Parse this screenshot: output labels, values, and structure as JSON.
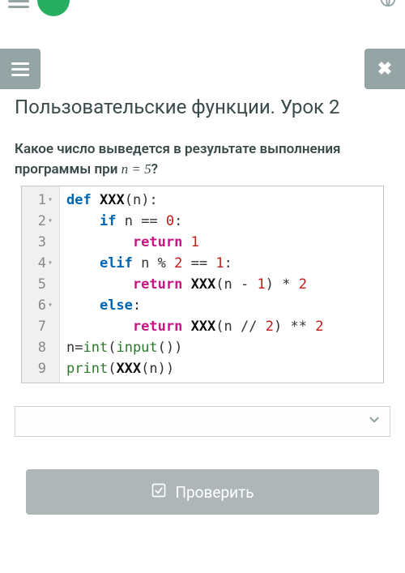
{
  "page": {
    "title": "Пользовательские функции. Урок 2"
  },
  "question": {
    "prefix": "Какое число выведется в результате выполнения программы при ",
    "var": "n",
    "eq": " = ",
    "val": "5",
    "suffix": "?"
  },
  "code": {
    "lines": [
      {
        "n": "1",
        "fold": true
      },
      {
        "n": "2",
        "fold": true
      },
      {
        "n": "3",
        "fold": false
      },
      {
        "n": "4",
        "fold": true
      },
      {
        "n": "5",
        "fold": false
      },
      {
        "n": "6",
        "fold": true
      },
      {
        "n": "7",
        "fold": false
      },
      {
        "n": "8",
        "fold": false
      },
      {
        "n": "9",
        "fold": false
      }
    ],
    "tokens": {
      "def": "def",
      "fn_name": "XXX",
      "param": "n",
      "if": "if",
      "eqeq": "==",
      "zero": "0",
      "one": "1",
      "two": "2",
      "return": "return",
      "elif": "elif",
      "mod": "%",
      "minus": "-",
      "star": "*",
      "floordiv": "//",
      "starstar": "**",
      "else": "else",
      "assign": "=",
      "int": "int",
      "input": "input",
      "print": "print"
    }
  },
  "buttons": {
    "check": "Проверить"
  },
  "answer": {
    "value": ""
  }
}
